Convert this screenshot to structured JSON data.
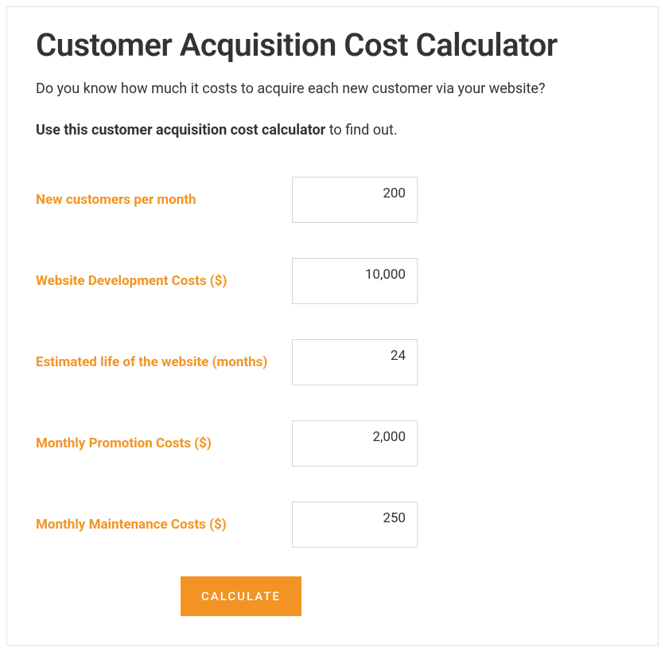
{
  "header": {
    "title": "Customer Acquisition Cost Calculator",
    "subtitle": "Do you know how much it costs to acquire each new customer via your website?",
    "instruction_bold": "Use this customer acquisition cost calculator",
    "instruction_rest": " to find out."
  },
  "form": {
    "fields": [
      {
        "label": "New customers per month",
        "value": "200"
      },
      {
        "label": "Website Development Costs ($)",
        "value": "10,000"
      },
      {
        "label": "Estimated life of the website (months)",
        "value": "24"
      },
      {
        "label": "Monthly Promotion Costs ($)",
        "value": "2,000"
      },
      {
        "label": "Monthly Maintenance Costs ($)",
        "value": "250"
      }
    ],
    "button_label": "CALCULATE"
  }
}
